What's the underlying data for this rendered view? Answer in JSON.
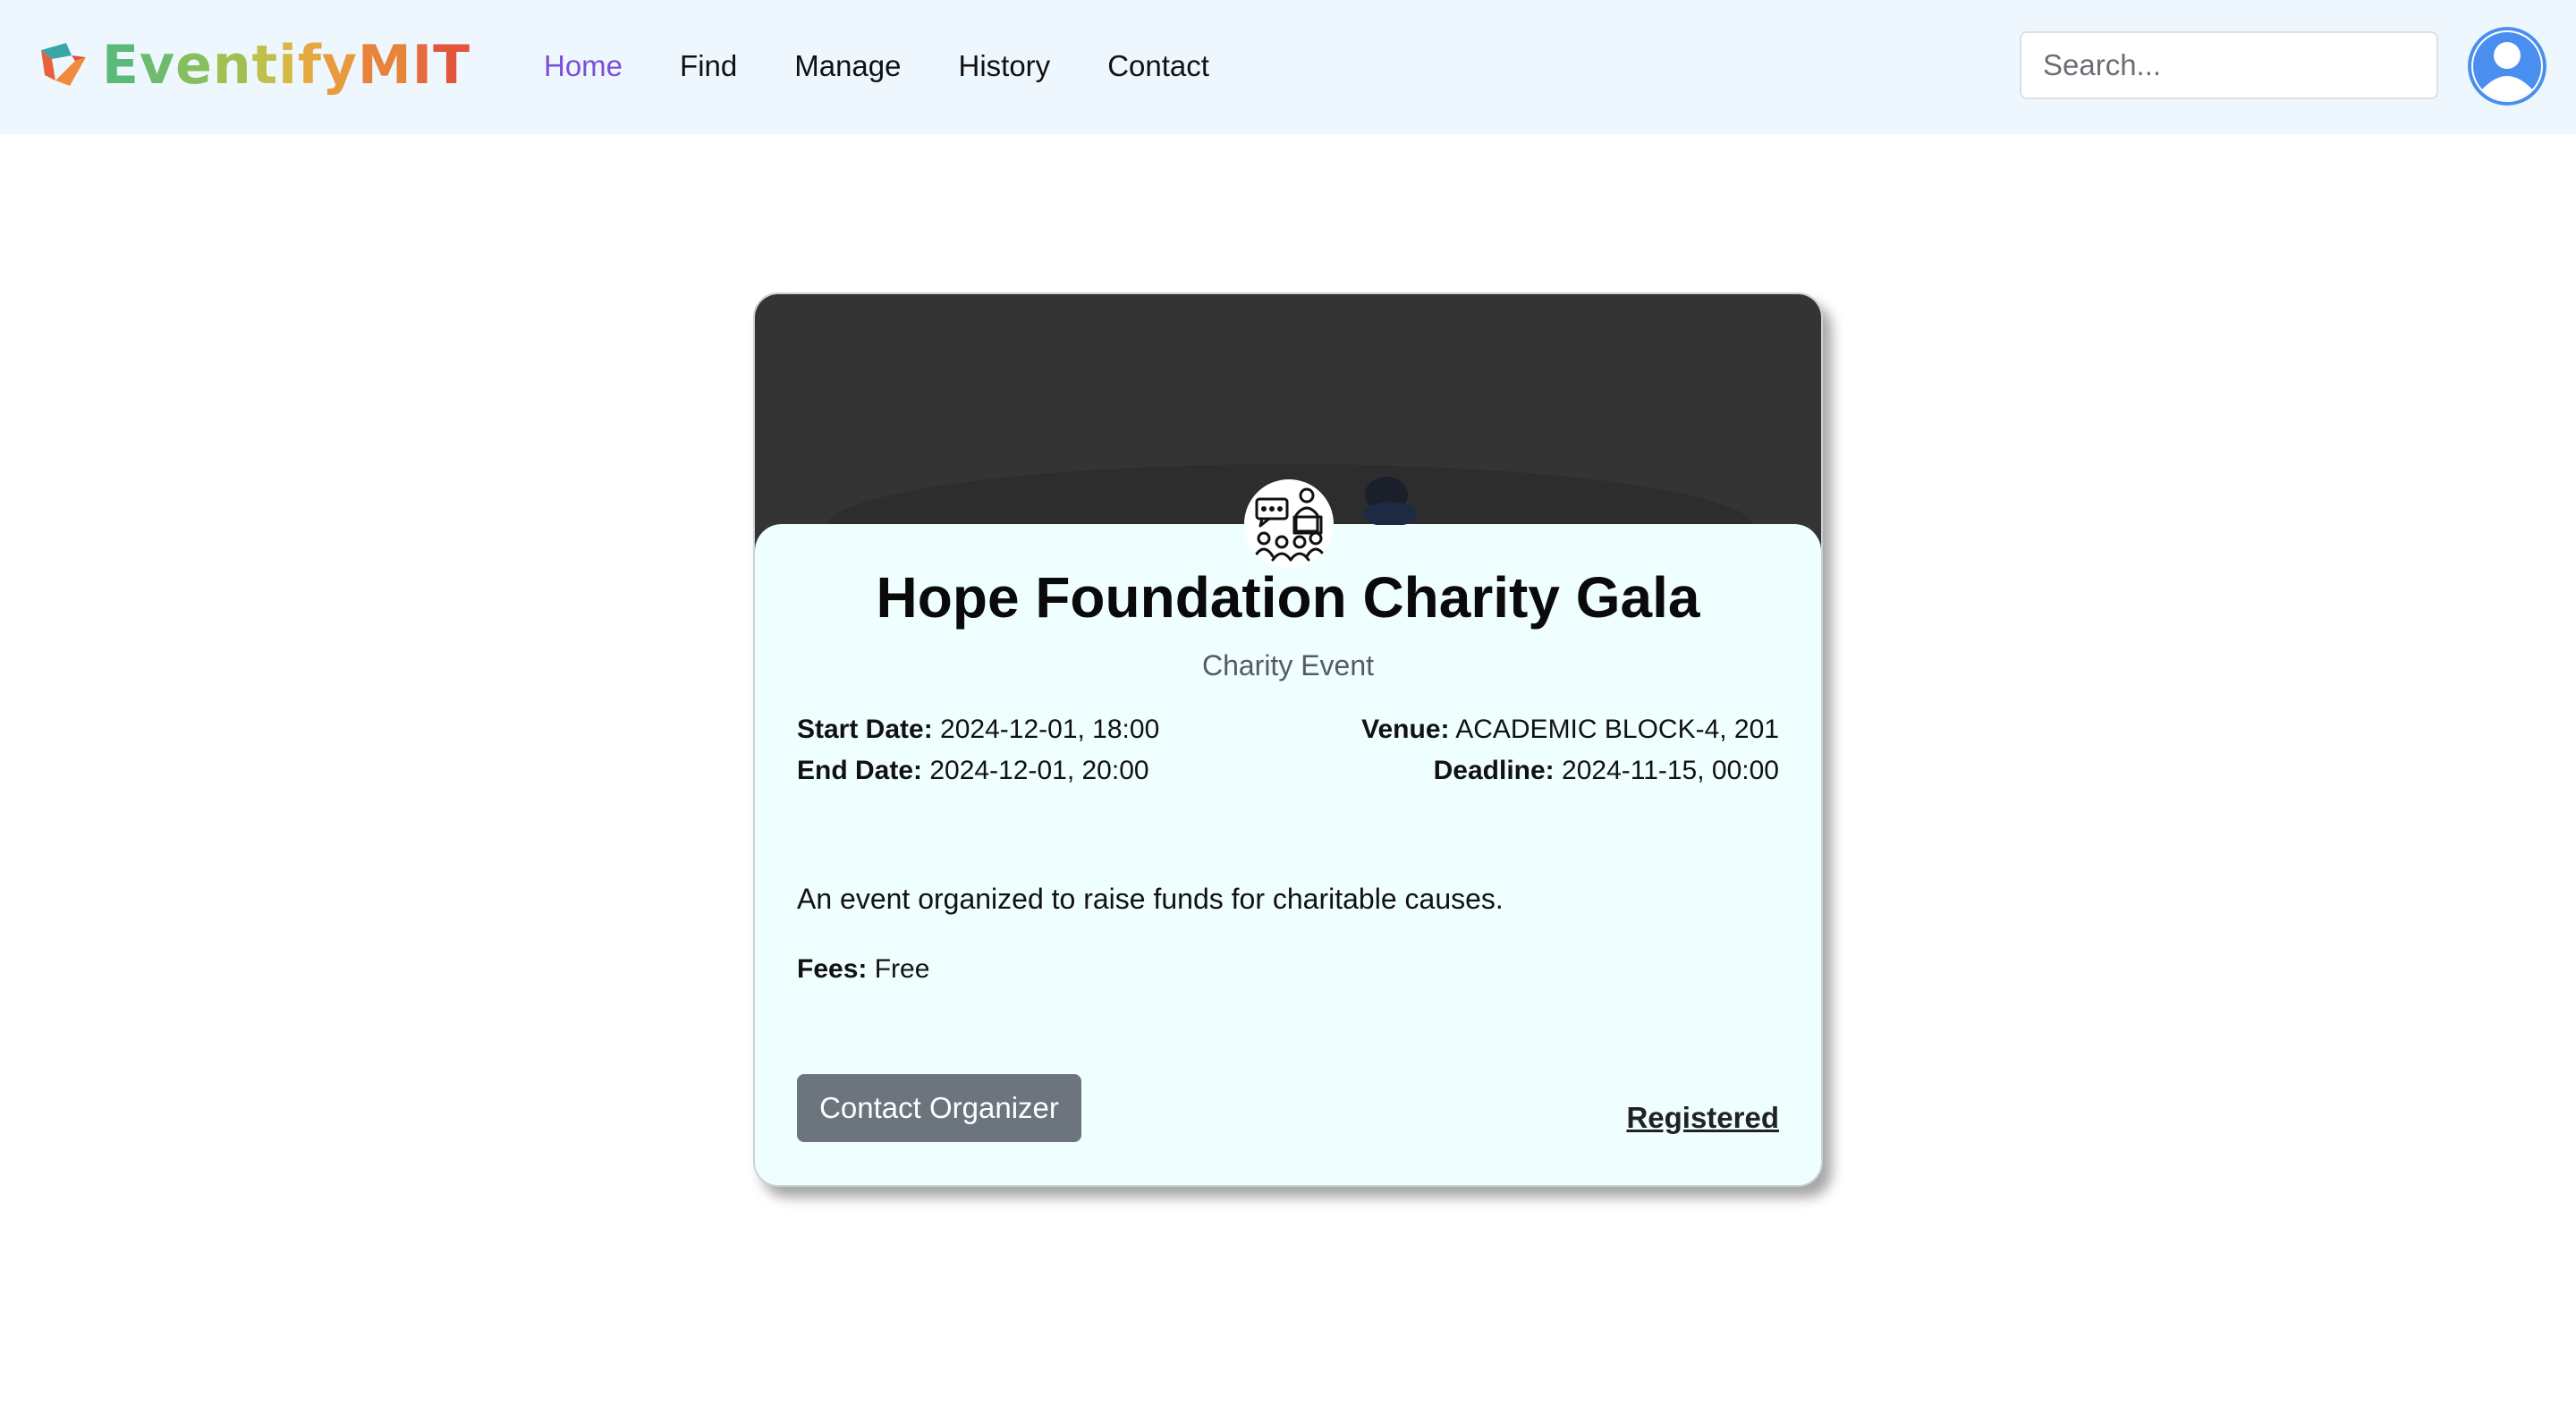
{
  "brand": {
    "name_parts": [
      {
        "text": "E",
        "color": "#5bb97a"
      },
      {
        "text": "v",
        "color": "#6dbb6d"
      },
      {
        "text": "e",
        "color": "#86bf5e"
      },
      {
        "text": "n",
        "color": "#a2c052"
      },
      {
        "text": "t",
        "color": "#bfbf4a"
      },
      {
        "text": "i",
        "color": "#d6b945"
      },
      {
        "text": "f",
        "color": "#e4aa41"
      },
      {
        "text": "y",
        "color": "#e89a3e"
      },
      {
        "text": "M",
        "color": "#e8833c"
      },
      {
        "text": "I",
        "color": "#e66b3c"
      },
      {
        "text": "T",
        "color": "#e4553d"
      }
    ],
    "icon": "eventify-logo-icon"
  },
  "nav": {
    "items": [
      {
        "label": "Home",
        "active": true
      },
      {
        "label": "Find",
        "active": false
      },
      {
        "label": "Manage",
        "active": false
      },
      {
        "label": "History",
        "active": false
      },
      {
        "label": "Contact",
        "active": false
      }
    ],
    "active_color": "#7b4fd6"
  },
  "search": {
    "placeholder": "Search..."
  },
  "user": {
    "avatar_icon": "user-avatar-icon",
    "avatar_color": "#4a8ff0"
  },
  "event": {
    "title": "Hope Foundation Charity Gala",
    "category": "Charity Event",
    "start_label": "Start Date:",
    "start_value": "2024-12-01, 18:00",
    "end_label": "End Date:",
    "end_value": "2024-12-01, 20:00",
    "venue_label": "Venue:",
    "venue_value": "ACADEMIC BLOCK-4, 201",
    "deadline_label": "Deadline:",
    "deadline_value": "2024-11-15, 00:00",
    "description": "An event organized to raise funds for charitable causes.",
    "fees_label": "Fees:",
    "fees_value": "Free",
    "icon": "presentation-audience-icon",
    "contact_button": "Contact Organizer",
    "status": "Registered"
  }
}
